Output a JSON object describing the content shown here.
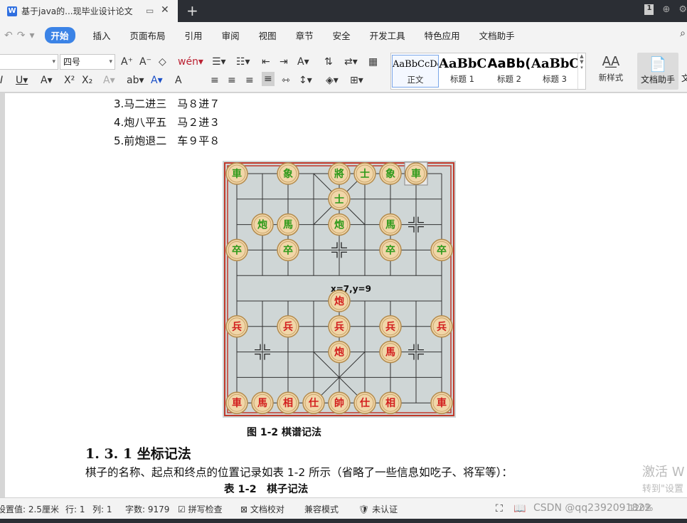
{
  "tab": {
    "title": "基于java的...现毕业设计论文",
    "icon_letter": "W"
  },
  "titlebar": {
    "page_badge": "1"
  },
  "menu": {
    "items": [
      "开始",
      "插入",
      "页面布局",
      "引用",
      "审阅",
      "视图",
      "章节",
      "安全",
      "开发工具",
      "特色应用",
      "文档助手"
    ],
    "active_index": 0
  },
  "ribbon": {
    "font_size": "四号",
    "styles": [
      {
        "sample": "AaBbCcDd",
        "label": "正文"
      },
      {
        "sample": "AaBbC",
        "label": "标题 1"
      },
      {
        "sample": "AaBb(",
        "label": "标题 2"
      },
      {
        "sample": "AaBbC",
        "label": "标题 3"
      }
    ],
    "new_style": "新样式",
    "doc_assistant": "文档助手",
    "doc_assistant_short": "文"
  },
  "document": {
    "moves": [
      "3.马二进三　马８进７",
      "4.炮八平五　马２进３",
      "5.前炮退二　车９平８"
    ],
    "board_coord": "x=7,y=9",
    "figure_caption": "图 1-2  棋谱记法",
    "section_heading": "1. 3. 1  坐标记法",
    "body_text": "棋子的名称、起点和终点的位置记录如表 1-2 所示（省略了一些信息如吃子、将军等）：",
    "table_caption": "表 1-2　棋子记法",
    "watermark_line1": "激活 W",
    "watermark_line2": "转到\"设置"
  },
  "board": {
    "green_pieces": [
      {
        "c": 0,
        "r": 0,
        "t": "車"
      },
      {
        "c": 2,
        "r": 0,
        "t": "象"
      },
      {
        "c": 4,
        "r": 0,
        "t": "將"
      },
      {
        "c": 5,
        "r": 0,
        "t": "士"
      },
      {
        "c": 6,
        "r": 0,
        "t": "象"
      },
      {
        "c": 7,
        "r": 0,
        "t": "車"
      },
      {
        "c": 4,
        "r": 1,
        "t": "士"
      },
      {
        "c": 1,
        "r": 2,
        "t": "炮"
      },
      {
        "c": 2,
        "r": 2,
        "t": "馬"
      },
      {
        "c": 4,
        "r": 2,
        "t": "炮"
      },
      {
        "c": 6,
        "r": 2,
        "t": "馬"
      },
      {
        "c": 0,
        "r": 3,
        "t": "卒"
      },
      {
        "c": 2,
        "r": 3,
        "t": "卒"
      },
      {
        "c": 6,
        "r": 3,
        "t": "卒"
      },
      {
        "c": 8,
        "r": 3,
        "t": "卒"
      }
    ],
    "red_pieces": [
      {
        "c": 4,
        "r": 5,
        "t": "炮"
      },
      {
        "c": 0,
        "r": 6,
        "t": "兵"
      },
      {
        "c": 2,
        "r": 6,
        "t": "兵"
      },
      {
        "c": 4,
        "r": 6,
        "t": "兵"
      },
      {
        "c": 6,
        "r": 6,
        "t": "兵"
      },
      {
        "c": 8,
        "r": 6,
        "t": "兵"
      },
      {
        "c": 4,
        "r": 7,
        "t": "炮"
      },
      {
        "c": 6,
        "r": 7,
        "t": "馬"
      },
      {
        "c": 0,
        "r": 9,
        "t": "車"
      },
      {
        "c": 1,
        "r": 9,
        "t": "馬"
      },
      {
        "c": 2,
        "r": 9,
        "t": "相"
      },
      {
        "c": 3,
        "r": 9,
        "t": "仕"
      },
      {
        "c": 4,
        "r": 9,
        "t": "帥"
      },
      {
        "c": 5,
        "r": 9,
        "t": "仕"
      },
      {
        "c": 6,
        "r": 9,
        "t": "相"
      },
      {
        "c": 8,
        "r": 9,
        "t": "車"
      }
    ],
    "selected": {
      "c": 7,
      "r": 0
    },
    "colors": {
      "green": "#2e9a1a",
      "red": "#d21e1e",
      "piece_face": "#f1d6a8",
      "board": "#cfd6d6",
      "frame": "#c0392b"
    }
  },
  "status": {
    "setting": "设置值: 2.5厘米",
    "row": "行: 1",
    "col": "列: 1",
    "wordcount": "字数: 9179",
    "spell": "拼写检查",
    "proof": "文档校对",
    "compat": "兼容模式",
    "cert": "未认证",
    "zoom": "120%",
    "csdn": "CSDN @qq2392091822"
  }
}
